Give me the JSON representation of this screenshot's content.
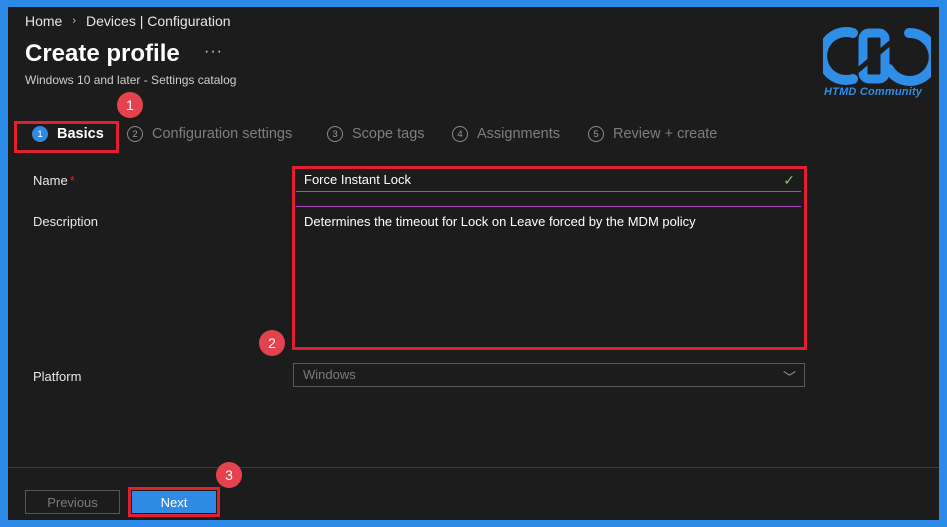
{
  "breadcrumb": {
    "home": "Home",
    "separator": "›",
    "section": "Devices | Configuration"
  },
  "page": {
    "title": "Create profile",
    "more": "···",
    "subtitle": "Windows 10 and later - Settings catalog"
  },
  "logo": {
    "text": "HTMD Community",
    "color": "#2f8ee6"
  },
  "tabs": [
    {
      "num": "1",
      "label": "Basics",
      "active": true
    },
    {
      "num": "2",
      "label": "Configuration settings",
      "active": false
    },
    {
      "num": "3",
      "label": "Scope tags",
      "active": false
    },
    {
      "num": "4",
      "label": "Assignments",
      "active": false
    },
    {
      "num": "5",
      "label": "Review + create",
      "active": false
    }
  ],
  "form": {
    "name_label": "Name",
    "required_mark": "*",
    "name_value": "Force Instant Lock",
    "valid_icon": "✓",
    "description_label": "Description",
    "description_value": "Determines the timeout for Lock on Leave forced by the MDM policy",
    "platform_label": "Platform",
    "platform_value": "Windows",
    "dropdown_icon": "﹀"
  },
  "footer": {
    "previous_label": "Previous",
    "next_label": "Next"
  },
  "annotations": {
    "badge1": "1",
    "badge2": "2",
    "badge3": "3"
  },
  "colors": {
    "accent": "#2f8ae3",
    "highlight": "#e0202e",
    "badge": "#e4434e",
    "background": "#1c1c1c",
    "border": "#2b8ae8"
  }
}
